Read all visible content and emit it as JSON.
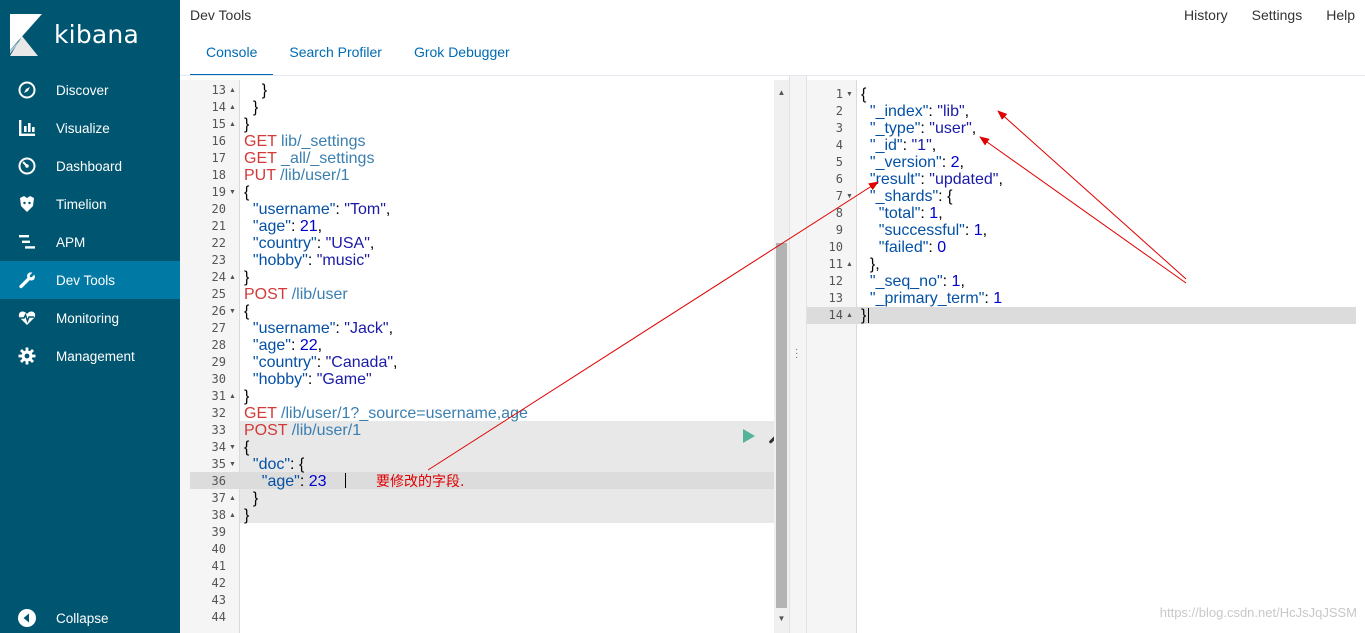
{
  "app": {
    "logo_text": "kibana",
    "page_title": "Dev Tools"
  },
  "top_links": [
    "History",
    "Settings",
    "Help"
  ],
  "tabs": [
    {
      "label": "Console",
      "active": true
    },
    {
      "label": "Search Profiler",
      "active": false
    },
    {
      "label": "Grok Debugger",
      "active": false
    }
  ],
  "sidebar": {
    "items": [
      {
        "label": "Discover",
        "icon": "compass-icon",
        "active": false
      },
      {
        "label": "Visualize",
        "icon": "bar-chart-icon",
        "active": false
      },
      {
        "label": "Dashboard",
        "icon": "dashboard-icon",
        "active": false
      },
      {
        "label": "Timelion",
        "icon": "timelion-icon",
        "active": false
      },
      {
        "label": "APM",
        "icon": "apm-icon",
        "active": false
      },
      {
        "label": "Dev Tools",
        "icon": "wrench-icon",
        "active": true
      },
      {
        "label": "Monitoring",
        "icon": "heartbeat-icon",
        "active": false
      },
      {
        "label": "Management",
        "icon": "gear-icon",
        "active": false
      }
    ],
    "collapse_label": "Collapse"
  },
  "request_editor": {
    "lines": [
      {
        "n": 13,
        "text": "    }",
        "fold": "up"
      },
      {
        "n": 14,
        "text": "  }",
        "fold": "up"
      },
      {
        "n": 15,
        "text": "}",
        "fold": "up"
      },
      {
        "n": 16,
        "method": "GET",
        "url": " lib/_settings"
      },
      {
        "n": 17,
        "method": "GET",
        "url": " _all/_settings"
      },
      {
        "n": 18,
        "method": "PUT",
        "url": " /lib/user/1"
      },
      {
        "n": 19,
        "text": "{",
        "fold": "down"
      },
      {
        "n": 20,
        "text": "  \"username\": \"Tom\","
      },
      {
        "n": 21,
        "text": "  \"age\": 21,"
      },
      {
        "n": 22,
        "text": "  \"country\": \"USA\","
      },
      {
        "n": 23,
        "text": "  \"hobby\": \"music\""
      },
      {
        "n": 24,
        "text": "}",
        "fold": "up"
      },
      {
        "n": 25,
        "method": "POST",
        "url": " /lib/user"
      },
      {
        "n": 26,
        "text": "{",
        "fold": "down"
      },
      {
        "n": 27,
        "text": "  \"username\": \"Jack\","
      },
      {
        "n": 28,
        "text": "  \"age\": 22,"
      },
      {
        "n": 29,
        "text": "  \"country\": \"Canada\","
      },
      {
        "n": 30,
        "text": "  \"hobby\": \"Game\""
      },
      {
        "n": 31,
        "text": "}",
        "fold": "up"
      },
      {
        "n": 32,
        "method": "GET",
        "url": " /lib/user/1?_source=username,age"
      },
      {
        "n": 33,
        "method": "POST",
        "url": " /lib/user/1"
      },
      {
        "n": 34,
        "text": "{",
        "fold": "down"
      },
      {
        "n": 35,
        "text": "  \"doc\": {",
        "fold": "down"
      },
      {
        "n": 36,
        "text": "    \"age\": 23"
      },
      {
        "n": 37,
        "text": "  }",
        "fold": "up"
      },
      {
        "n": 38,
        "text": "}",
        "fold": "up"
      },
      {
        "n": 39,
        "text": ""
      },
      {
        "n": 40,
        "text": ""
      },
      {
        "n": 41,
        "text": ""
      },
      {
        "n": 42,
        "text": ""
      },
      {
        "n": 43,
        "text": ""
      },
      {
        "n": 44,
        "text": ""
      }
    ]
  },
  "response_editor": {
    "lines": [
      {
        "n": 1,
        "text": "{",
        "fold": "down"
      },
      {
        "n": 2,
        "text": "  \"_index\": \"lib\","
      },
      {
        "n": 3,
        "text": "  \"_type\": \"user\","
      },
      {
        "n": 4,
        "text": "  \"_id\": \"1\","
      },
      {
        "n": 5,
        "text": "  \"_version\": 2,"
      },
      {
        "n": 6,
        "text": "  \"result\": \"updated\","
      },
      {
        "n": 7,
        "text": "  \"_shards\": {",
        "fold": "down"
      },
      {
        "n": 8,
        "text": "    \"total\": 1,"
      },
      {
        "n": 9,
        "text": "    \"successful\": 1,"
      },
      {
        "n": 10,
        "text": "    \"failed\": 0"
      },
      {
        "n": 11,
        "text": "  },",
        "fold": "up"
      },
      {
        "n": 12,
        "text": "  \"_seq_no\": 1,"
      },
      {
        "n": 13,
        "text": "  \"_primary_term\": 1"
      },
      {
        "n": 14,
        "text": "}",
        "fold": "up"
      }
    ]
  },
  "annotation_text": "要修改的字段.",
  "watermark_text": "https://blog.csdn.net/HcJsJqJSSM",
  "colors": {
    "sidebar_bg": "#005571",
    "sidebar_active": "#0079a5",
    "accent": "#006bb4",
    "method": "#d23a3a",
    "arrow": "#e00000",
    "play": "#54b399"
  }
}
